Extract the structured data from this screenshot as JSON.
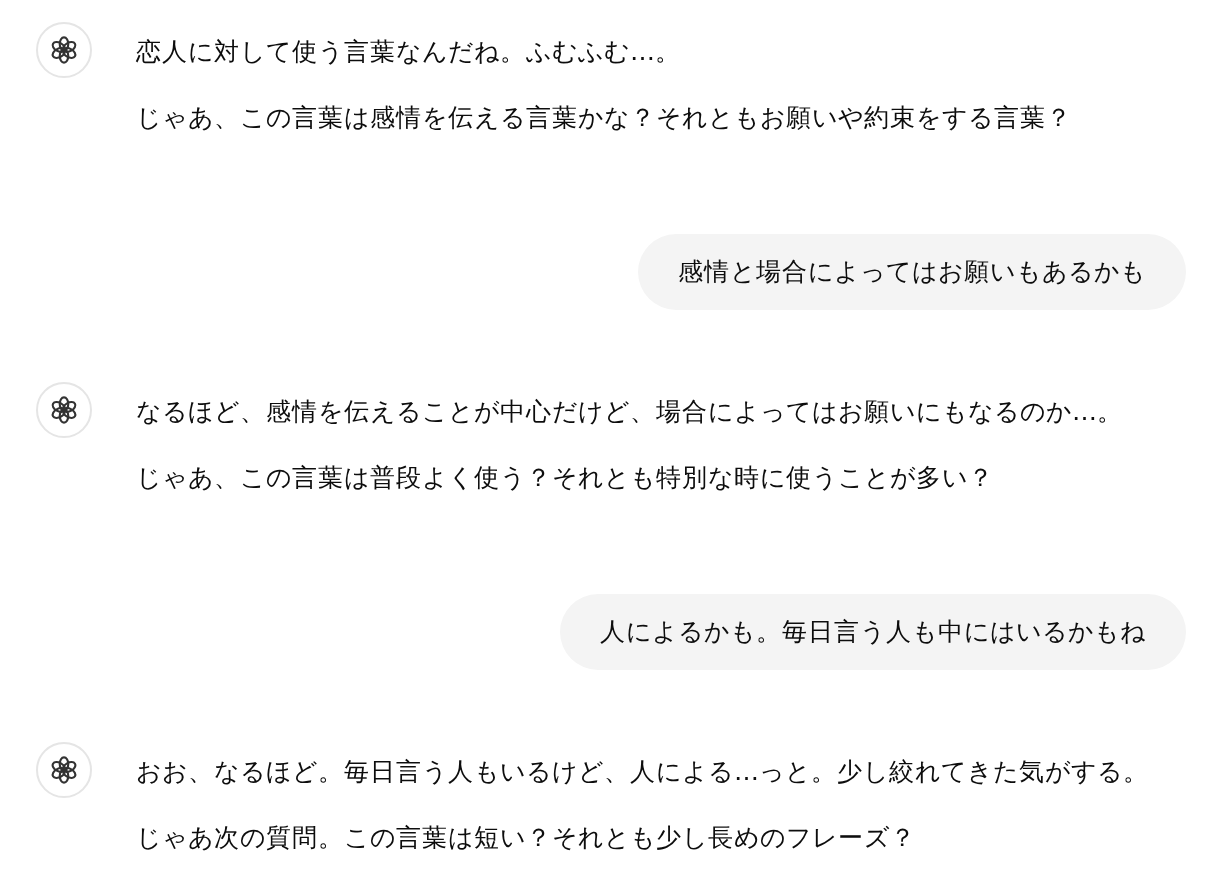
{
  "messages": [
    {
      "kind": "assistant",
      "paragraphs": [
        "恋人に対して使う言葉なんだね。ふむふむ…。",
        "じゃあ、この言葉は感情を伝える言葉かな？それともお願いや約束をする言葉？"
      ]
    },
    {
      "kind": "user",
      "text": "感情と場合によってはお願いもあるかも"
    },
    {
      "kind": "assistant",
      "paragraphs": [
        "なるほど、感情を伝えることが中心だけど、場合によってはお願いにもなるのか…。",
        "じゃあ、この言葉は普段よく使う？それとも特別な時に使うことが多い？"
      ]
    },
    {
      "kind": "user",
      "text": "人によるかも。毎日言う人も中にはいるかもね"
    },
    {
      "kind": "assistant",
      "paragraphs": [
        "おお、なるほど。毎日言う人もいるけど、人による…っと。少し絞れてきた気がする。",
        "じゃあ次の質問。この言葉は短い？それとも少し長めのフレーズ？"
      ]
    }
  ]
}
